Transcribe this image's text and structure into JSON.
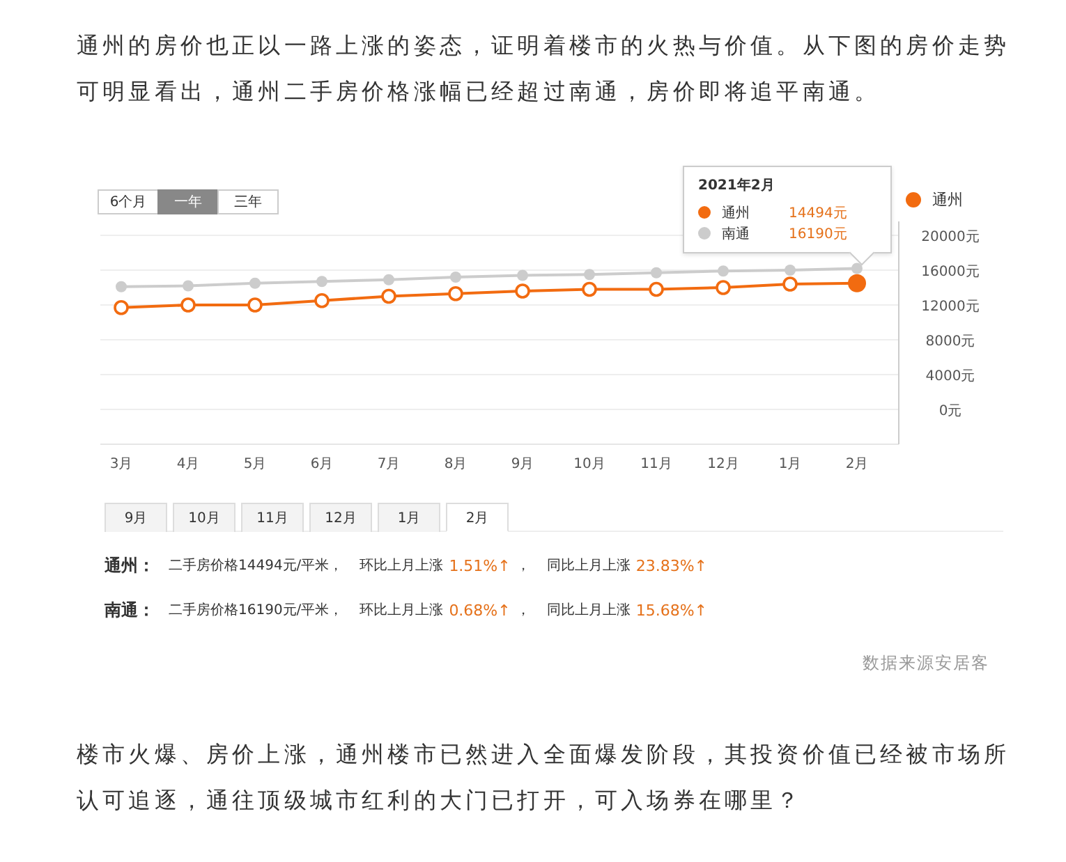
{
  "intro": "通州的房价也正以一路上涨的姿态，证明着楼市的火热与价值。从下图的房价走势可明显看出，通州二手房价格涨幅已经超过南通，房价即将追平南通。",
  "chart": {
    "range_buttons": [
      {
        "label": "6个月",
        "selected": false
      },
      {
        "label": "一年",
        "selected": true
      },
      {
        "label": "三年",
        "selected": false
      }
    ],
    "legend": [
      {
        "label": "通州",
        "color": "#f26b10"
      }
    ],
    "point_styles": [
      {
        "hollow": true
      },
      {
        "hollow": false
      }
    ],
    "tooltip": {
      "title": "2021年2月",
      "rows": [
        {
          "value": "14494元",
          "color": "#f26b10"
        },
        {
          "value": "16190元",
          "color": "#cccccc"
        }
      ]
    },
    "chart_data": {
      "type": "line",
      "categories": [
        "3月",
        "4月",
        "5月",
        "6月",
        "7月",
        "8月",
        "9月",
        "10月",
        "11月",
        "12月",
        "1月",
        "2月"
      ],
      "grid": true,
      "series": [
        {
          "name": "通州",
          "color": "#f26b10",
          "marker": "circle",
          "values": [
            11700,
            12000,
            12000,
            12500,
            13000,
            13300,
            13600,
            13800,
            13800,
            14000,
            14400,
            14500
          ]
        },
        {
          "name": "南通",
          "color": "#cccccc",
          "marker": "circle",
          "values": [
            14100,
            14200,
            14500,
            14700,
            14900,
            15200,
            15400,
            15500,
            15700,
            15900,
            16000,
            16200
          ]
        }
      ],
      "ylim": [
        0,
        20000
      ],
      "yticks": [
        {
          "value": 20000,
          "label": "20000元"
        },
        {
          "value": 16000,
          "label": "16000元"
        },
        {
          "value": 12000,
          "label": "12000元"
        },
        {
          "value": 8000,
          "label": "8000元"
        },
        {
          "value": 4000,
          "label": "4000元"
        },
        {
          "value": 0,
          "label": "0元"
        }
      ]
    }
  },
  "month_tabs": [
    {
      "label": "9月",
      "selected": false
    },
    {
      "label": "10月",
      "selected": false
    },
    {
      "label": "11月",
      "selected": false
    },
    {
      "label": "12月",
      "selected": false
    },
    {
      "label": "1月",
      "selected": false
    },
    {
      "label": "2月",
      "selected": true
    }
  ],
  "stats": [
    {
      "city": "通州：",
      "price": "二手房价格14494元/平米，",
      "mom_label": "环比上月上涨",
      "mom": "1.51%↑",
      "sep": "，",
      "yoy_label": "同比上月上涨",
      "yoy": "23.83%↑"
    },
    {
      "city": "南通：",
      "price": "二手房价格16190元/平米，",
      "mom_label": "环比上月上涨",
      "mom": "0.68%↑",
      "sep": "，",
      "yoy_label": "同比上月上涨",
      "yoy": "15.68%↑"
    }
  ],
  "source": "数据来源安居客",
  "outro": "楼市火爆、房价上涨，通州楼市已然进入全面爆发阶段，其投资价值已经被市场所认可追逐，通往顶级城市红利的大门已打开，可入场券在哪里？"
}
